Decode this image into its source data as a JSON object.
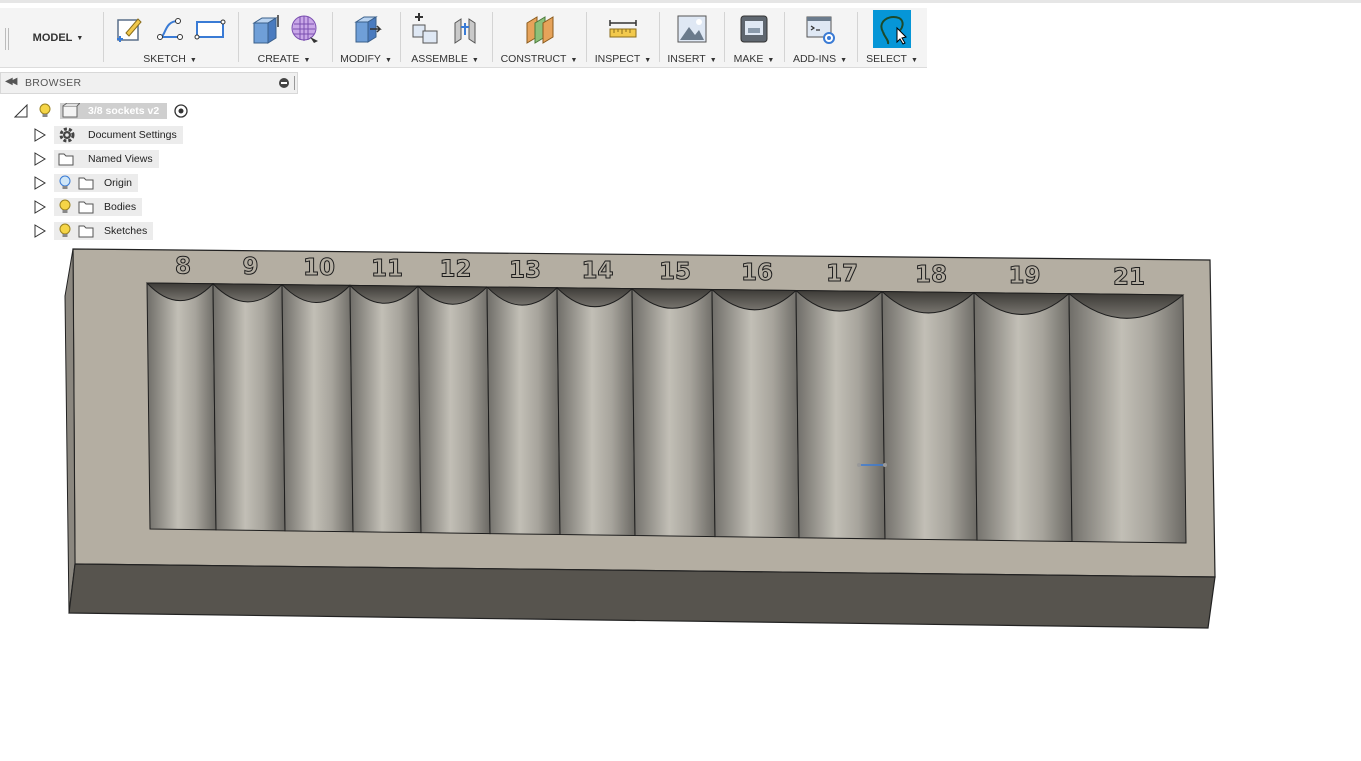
{
  "toolbar": {
    "workspace": "MODEL",
    "groups": {
      "sketch": "SKETCH",
      "create": "CREATE",
      "modify": "MODIFY",
      "assemble": "ASSEMBLE",
      "construct": "CONSTRUCT",
      "inspect": "INSPECT",
      "insert": "INSERT",
      "make": "MAKE",
      "addins": "ADD-INS",
      "select": "SELECT"
    }
  },
  "browser": {
    "title": "BROWSER",
    "root": "3/8 sockets v2",
    "items": [
      {
        "label": "Document Settings"
      },
      {
        "label": "Named Views"
      },
      {
        "label": "Origin"
      },
      {
        "label": "Bodies"
      },
      {
        "label": "Sketches"
      }
    ]
  },
  "model": {
    "socket_sizes": [
      "8",
      "9",
      "10",
      "11",
      "12",
      "13",
      "14",
      "15",
      "16",
      "17",
      "18",
      "19",
      "21"
    ]
  },
  "colors": {
    "accent": "#0696d7",
    "body_top": "#b4aea2",
    "body_front": "#57544e",
    "pocket": "#9c9a93"
  }
}
